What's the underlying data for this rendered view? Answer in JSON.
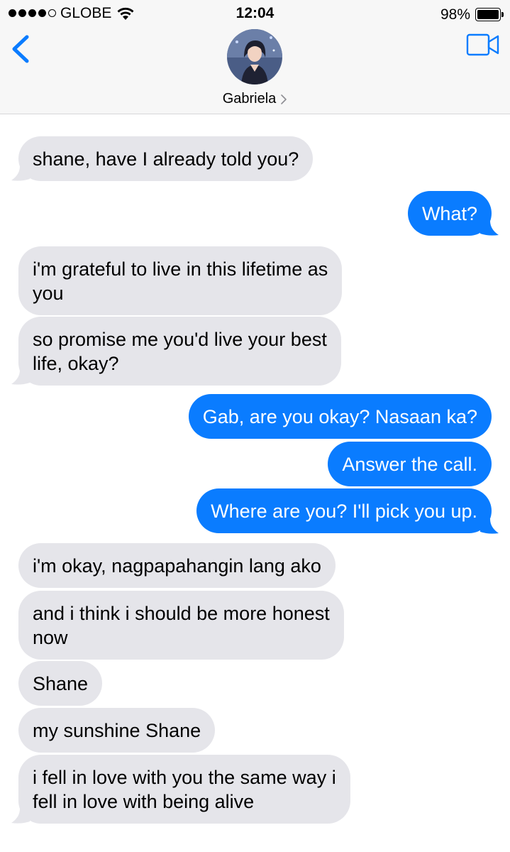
{
  "status_bar": {
    "carrier": "GLOBE",
    "time": "12:04",
    "battery_percent": "98%"
  },
  "header": {
    "contact_name": "Gabriela",
    "back_icon": "chevron-left-icon",
    "video_icon": "video-camera-icon",
    "accent_color": "#0a7cff"
  },
  "colors": {
    "incoming_bubble": "#e5e5ea",
    "outgoing_bubble": "#0a7cff"
  },
  "messages": [
    {
      "direction": "in",
      "text": "shane, have I already told you?"
    },
    {
      "direction": "out",
      "text": "What?"
    },
    {
      "direction": "in",
      "text": "i'm grateful to live in this lifetime as\nyou"
    },
    {
      "direction": "in",
      "text": "so promise me you'd live your best\nlife, okay?"
    },
    {
      "direction": "out",
      "text": "Gab, are you okay? Nasaan ka?"
    },
    {
      "direction": "out",
      "text": "Answer the call."
    },
    {
      "direction": "out",
      "text": "Where are you? I'll pick you up."
    },
    {
      "direction": "in",
      "text": "i'm okay, nagpapahangin lang ako"
    },
    {
      "direction": "in",
      "text": "and i think i should be more honest\nnow"
    },
    {
      "direction": "in",
      "text": "Shane"
    },
    {
      "direction": "in",
      "text": "my sunshine Shane"
    },
    {
      "direction": "in",
      "text": "i fell in love with you the same way i\nfell in love with being alive"
    }
  ]
}
